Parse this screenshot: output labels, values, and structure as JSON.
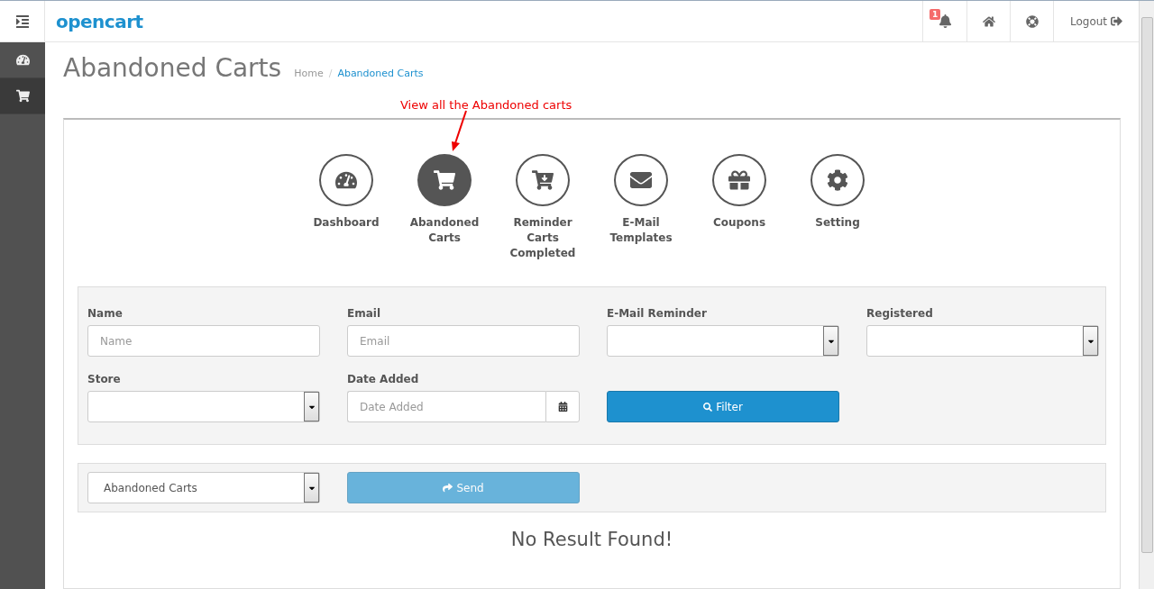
{
  "header": {
    "logo": "opencart",
    "notification_count": "1",
    "logout": "Logout"
  },
  "sidebar": {
    "items": [
      {
        "kind": "dashboard",
        "selected": false
      },
      {
        "kind": "cart",
        "selected": true
      }
    ]
  },
  "page": {
    "title": "Abandoned Carts",
    "breadcrumb_separator": "/",
    "breadcrumb": [
      {
        "label": "Home",
        "active": false
      },
      {
        "label": "Abandoned Carts",
        "active": true
      }
    ]
  },
  "annotation": "View all the Abandoned carts",
  "modules": [
    {
      "label": "Dashboard",
      "kind": "dashboard",
      "selected": false
    },
    {
      "label": "Abandoned Carts",
      "kind": "cart",
      "selected": true
    },
    {
      "label": "Reminder Carts Completed",
      "kind": "cart-download",
      "selected": false
    },
    {
      "label": "E-Mail Templates",
      "kind": "envelope",
      "selected": false
    },
    {
      "label": "Coupons",
      "kind": "gift",
      "selected": false
    },
    {
      "label": "Setting",
      "kind": "gear",
      "selected": false
    }
  ],
  "filters": [
    {
      "label": "Name",
      "kind": "text",
      "placeholder": "Name"
    },
    {
      "label": "Email",
      "kind": "text",
      "placeholder": "Email"
    },
    {
      "label": "E-Mail Reminder",
      "kind": "select"
    },
    {
      "label": "Registered",
      "kind": "select"
    },
    {
      "label": "Store",
      "kind": "select"
    },
    {
      "label": "Date Added",
      "kind": "date",
      "placeholder": "Date Added"
    }
  ],
  "filter_button": "Filter",
  "bulk": {
    "template": "Abandoned Carts",
    "send": "Send",
    "send_disabled": true
  },
  "empty_message": "No Result Found!"
}
